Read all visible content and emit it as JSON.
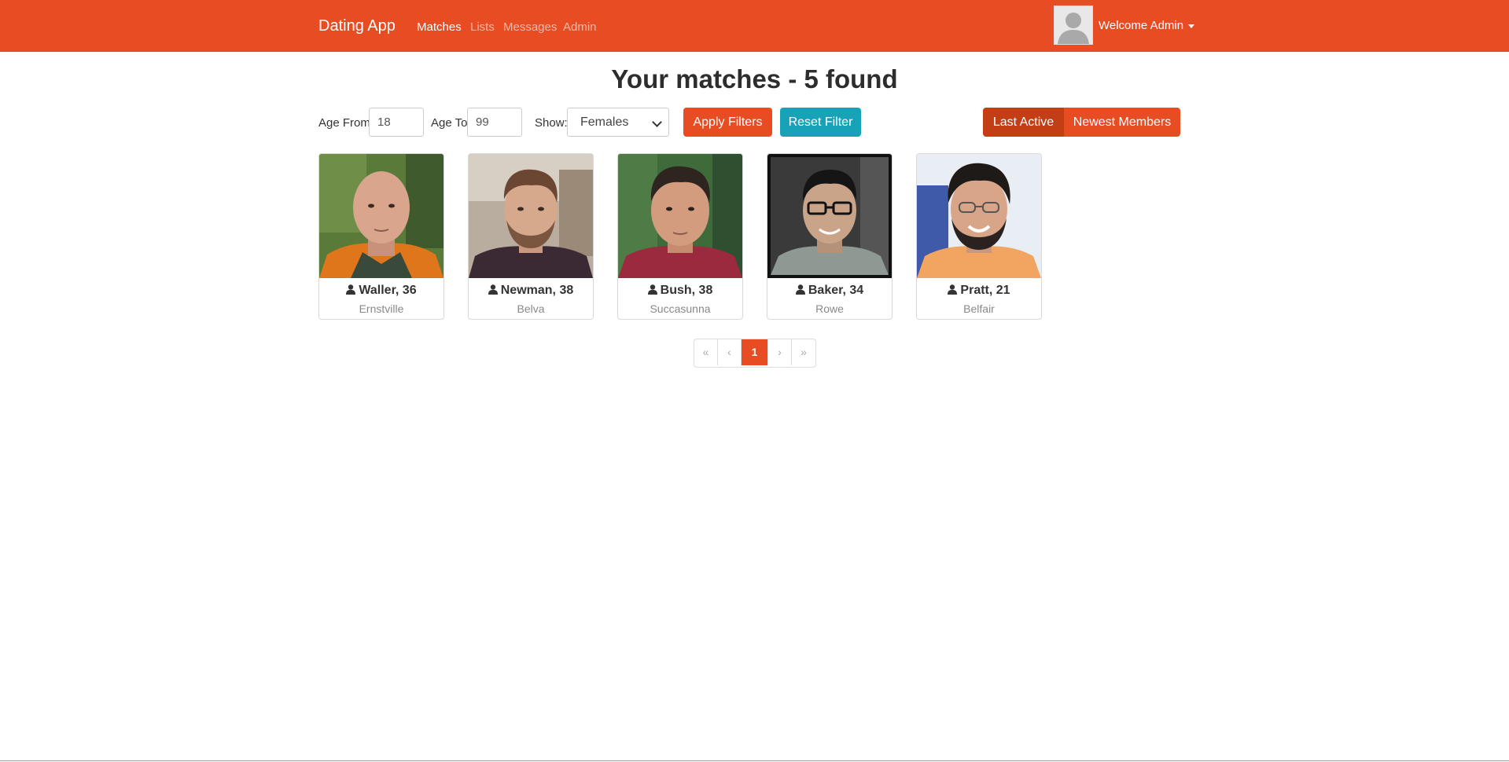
{
  "navbar": {
    "brand": "Dating App",
    "links": [
      "Matches",
      "Lists",
      "Messages",
      "Admin"
    ],
    "active_link": "Matches",
    "welcome": "Welcome Admin",
    "color": "#e84c22"
  },
  "page": {
    "title": "Your matches - 5 found"
  },
  "filters": {
    "age_from_label": "Age From",
    "age_from_value": "18",
    "age_to_label": "Age To",
    "age_to_value": "99",
    "show_label": "Show:",
    "show_value": "Females",
    "apply_label": "Apply Filters",
    "reset_label": "Reset Filter",
    "order_last_active": "Last Active",
    "order_newest": "Newest Members",
    "active_order": "Last Active"
  },
  "members": [
    {
      "name": "Waller, 36",
      "city": "Ernstville"
    },
    {
      "name": "Newman, 38",
      "city": "Belva"
    },
    {
      "name": "Bush, 38",
      "city": "Succasunna"
    },
    {
      "name": "Baker, 34",
      "city": "Rowe"
    },
    {
      "name": "Pratt, 21",
      "city": "Belfair"
    }
  ],
  "pagination": {
    "first": "«",
    "prev": "‹",
    "current": "1",
    "next": "›",
    "last": "»"
  },
  "colors": {
    "accent": "#e84c22",
    "accent_dark": "#c33d15",
    "info": "#17a2b8"
  }
}
